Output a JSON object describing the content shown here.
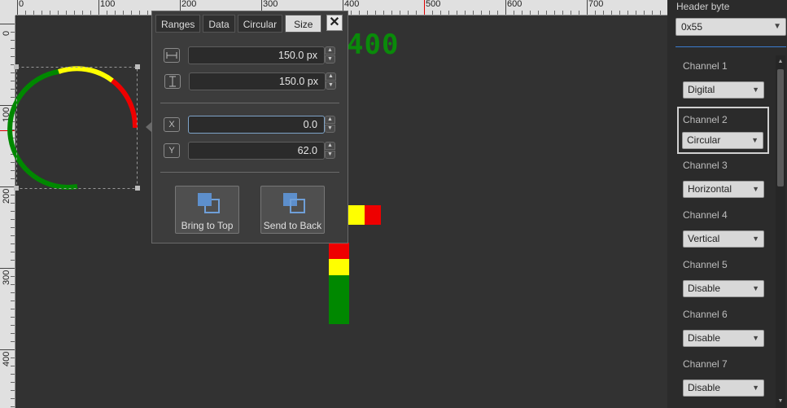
{
  "rulers": {
    "top_labels": [
      "0",
      "100",
      "200",
      "300",
      "400",
      "500",
      "600",
      "700"
    ],
    "left_labels": [
      "0",
      "100",
      "200",
      "300",
      "400"
    ]
  },
  "canvas": {
    "segment_display_text": "400",
    "gauge_colors": {
      "green": "#008800",
      "yellow": "#ffff00",
      "red": "#ee0000"
    }
  },
  "popup": {
    "tabs": [
      "Ranges",
      "Data",
      "Circular",
      "Size"
    ],
    "active_tab": "Size",
    "close_label": "✕",
    "width_value": "150.0 px",
    "height_value": "150.0 px",
    "x_icon": "X",
    "x_value": "0.0",
    "y_icon": "Y",
    "y_value": "62.0",
    "bring_to_top_label": "Bring to Top",
    "send_to_back_label": "Send to Back"
  },
  "right_panel": {
    "header_byte_label": "Header byte",
    "header_byte_value": "0x55",
    "channels": [
      {
        "label": "Channel 1",
        "value": "Digital"
      },
      {
        "label": "Channel 2",
        "value": "Circular"
      },
      {
        "label": "Channel 3",
        "value": "Horizontal"
      },
      {
        "label": "Channel 4",
        "value": "Vertical"
      },
      {
        "label": "Channel 5",
        "value": "Disable"
      },
      {
        "label": "Channel 6",
        "value": "Disable"
      },
      {
        "label": "Channel 7",
        "value": "Disable"
      }
    ],
    "selected_channel": "Channel 2"
  },
  "icons": [
    "width-icon",
    "height-icon",
    "chevron-down-icon",
    "close-icon",
    "bring-to-top-icon",
    "send-to-back-icon"
  ]
}
